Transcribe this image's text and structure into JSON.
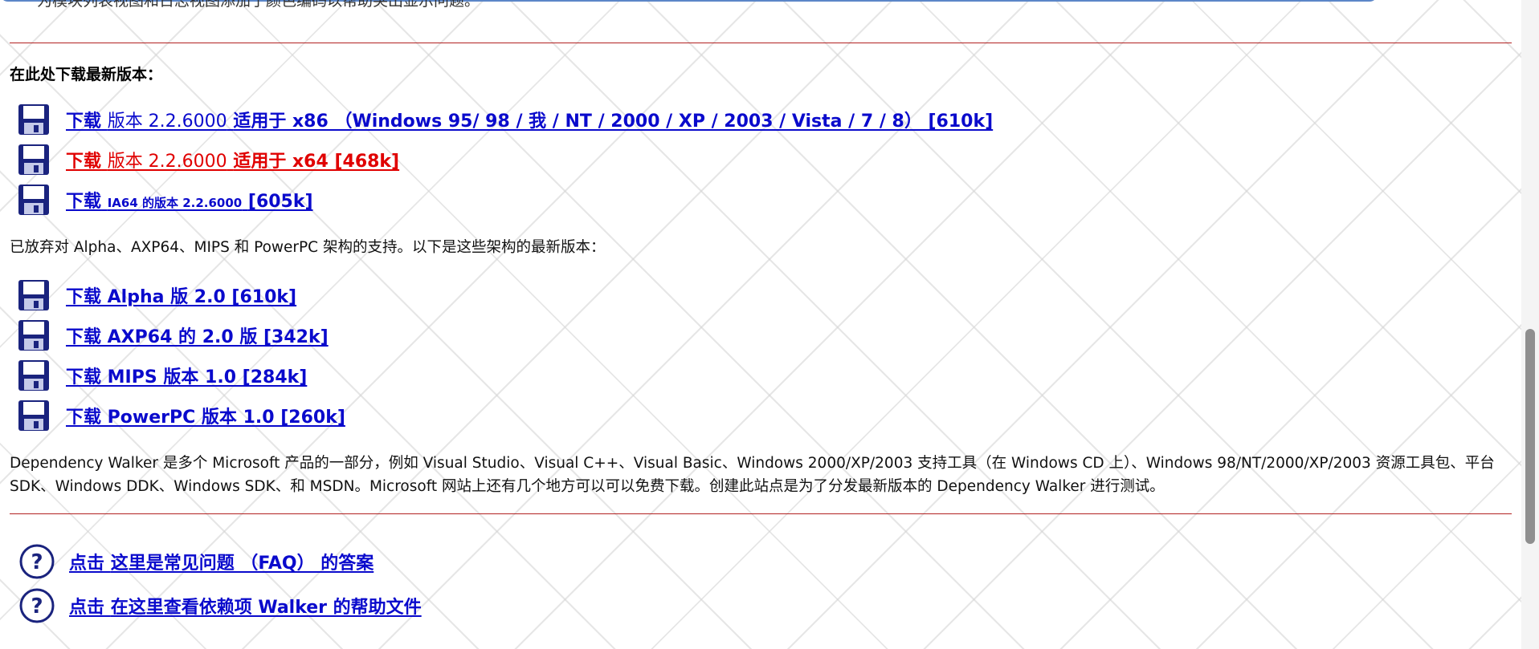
{
  "top_note": "为模块列表视图和日志视图添加了颜色编码以帮助突出显示问题。",
  "heading": "在此处下载最新版本：",
  "current_downloads": [
    {
      "download": "下载",
      "version": "版本 2.2.6000",
      "rest": "适用于 x86 （Windows 95/ 98 / 我 / NT / 2000 / XP / 2003 / Vista / 7 / 8） [610k]"
    },
    {
      "download": "下载",
      "version": "版本 2.2.6000",
      "rest": "适用于 x64 [468k]"
    },
    {
      "download": "下载",
      "small": "IA64 的版本 2.2.6000",
      "rest": "[605k]"
    }
  ],
  "legacy_intro": "已放弃对 Alpha、AXP64、MIPS 和 PowerPC 架构的支持。以下是这些架构的最新版本：",
  "legacy_downloads": [
    {
      "label": "下载 Alpha 版 2.0 [610k]"
    },
    {
      "label": "下载 AXP64 的 2.0 版 [342k]"
    },
    {
      "label": "下载 MIPS 版本 1.0 [284k]"
    },
    {
      "label": "下载 PowerPC 版本 1.0 [260k]"
    }
  ],
  "about_paragraph": "Dependency Walker 是多个 Microsoft 产品的一部分，例如 Visual Studio、Visual C++、Visual Basic、Windows 2000/XP/2003 支持工具（在 Windows CD 上）、Windows 98/NT/2000/XP/2003 资源工具包、平台 SDK、Windows DDK、Windows SDK、和 MSDN。Microsoft 网站上还有几个地方可以可以免费下载。创建此站点是为了分发最新版本的 Dependency Walker 进行测试。",
  "help_links": [
    {
      "click": "点击",
      "rest": "这里是常见问题 （FAQ） 的答案"
    },
    {
      "click": "点击",
      "rest": "在这里查看依赖项 Walker 的帮助文件"
    }
  ],
  "colors": {
    "link": "#0a0acc",
    "link_hover": "#e00000",
    "rule": "#b22222",
    "disk_icon": "#1a237e"
  }
}
